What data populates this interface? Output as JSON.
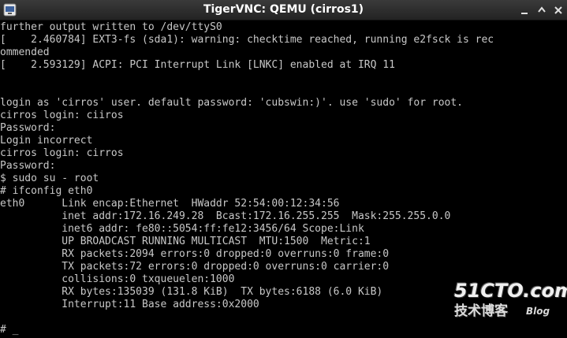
{
  "window": {
    "title": "TigerVNC: QEMU (cirros1)"
  },
  "terminal": {
    "lines": [
      "further output written to /dev/ttyS0",
      "[    2.460784] EXT3-fs (sda1): warning: checktime reached, running e2fsck is rec",
      "ommended",
      "[    2.593129] ACPI: PCI Interrupt Link [LNKC] enabled at IRQ 11",
      "",
      "",
      "login as 'cirros' user. default password: 'cubswin:)'. use 'sudo' for root.",
      "cirros login: ciiros",
      "Password:",
      "Login incorrect",
      "cirros login: cirros",
      "Password:",
      "$ sudo su - root",
      "# ifconfig eth0",
      "eth0      Link encap:Ethernet  HWaddr 52:54:00:12:34:56",
      "          inet addr:172.16.249.28  Bcast:172.16.255.255  Mask:255.255.0.0",
      "          inet6 addr: fe80::5054:ff:fe12:3456/64 Scope:Link",
      "          UP BROADCAST RUNNING MULTICAST  MTU:1500  Metric:1",
      "          RX packets:2094 errors:0 dropped:0 overruns:0 frame:0",
      "          TX packets:72 errors:0 dropped:0 overruns:0 carrier:0",
      "          collisions:0 txqueuelen:1000",
      "          RX bytes:135039 (131.8 KiB)  TX bytes:6188 (6.0 KiB)",
      "          Interrupt:11 Base address:0x2000",
      "",
      "# _"
    ]
  },
  "watermark": {
    "brand": "51CTO.com",
    "subtitle": "技术博客",
    "blog": "Blog"
  },
  "icons": {
    "app": "vnc-app-icon",
    "minimize": "minimize-icon",
    "maximize": "maximize-icon",
    "close": "close-icon"
  }
}
